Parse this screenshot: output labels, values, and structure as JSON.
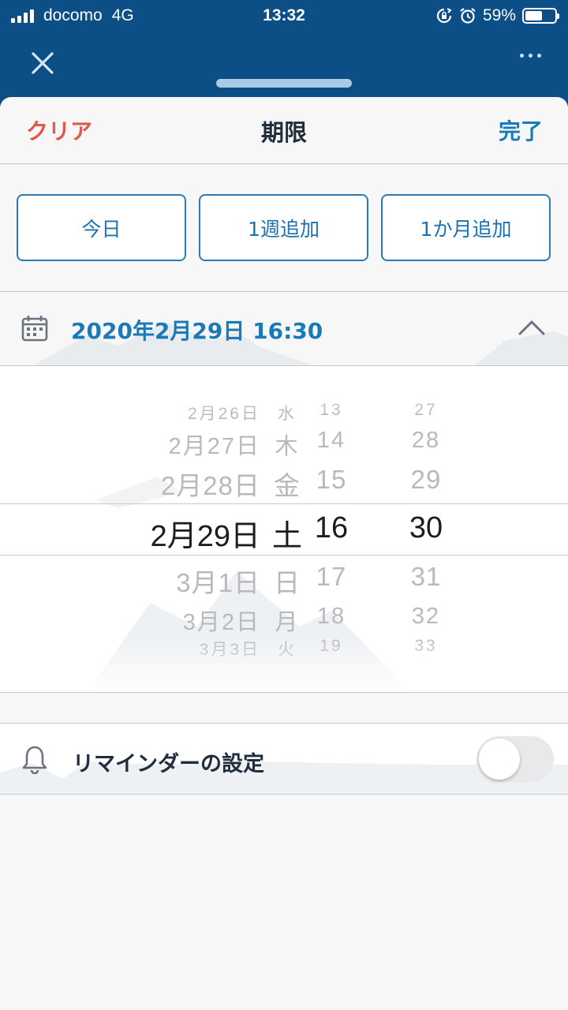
{
  "status_bar": {
    "carrier": "docomo",
    "network": "4G",
    "time": "13:32",
    "battery": "59%",
    "battery_level": 0.59
  },
  "sheet": {
    "clear_label": "クリア",
    "title": "期限",
    "done_label": "完了"
  },
  "quick_buttons": [
    "今日",
    "1週追加",
    "1か月追加"
  ],
  "due_date": {
    "value": "2020年2月29日 16:30"
  },
  "picker": {
    "rows": [
      {
        "date": "2月26日",
        "weekday": "水",
        "hour": "13",
        "minute": "27"
      },
      {
        "date": "2月27日",
        "weekday": "木",
        "hour": "14",
        "minute": "28"
      },
      {
        "date": "2月28日",
        "weekday": "金",
        "hour": "15",
        "minute": "29"
      },
      {
        "date": "2月29日",
        "weekday": "土",
        "hour": "16",
        "minute": "30"
      },
      {
        "date": "3月1日",
        "weekday": "日",
        "hour": "17",
        "minute": "31"
      },
      {
        "date": "3月2日",
        "weekday": "月",
        "hour": "18",
        "minute": "32"
      },
      {
        "date": "3月3日",
        "weekday": "火",
        "hour": "19",
        "minute": "33"
      }
    ],
    "selected_index": 3
  },
  "reminder": {
    "label": "リマインダーの設定",
    "enabled": false
  },
  "colors": {
    "header_bg": "#0b4f86",
    "accent_blue": "#1a7ab8",
    "clear_red": "#e05a4b"
  }
}
